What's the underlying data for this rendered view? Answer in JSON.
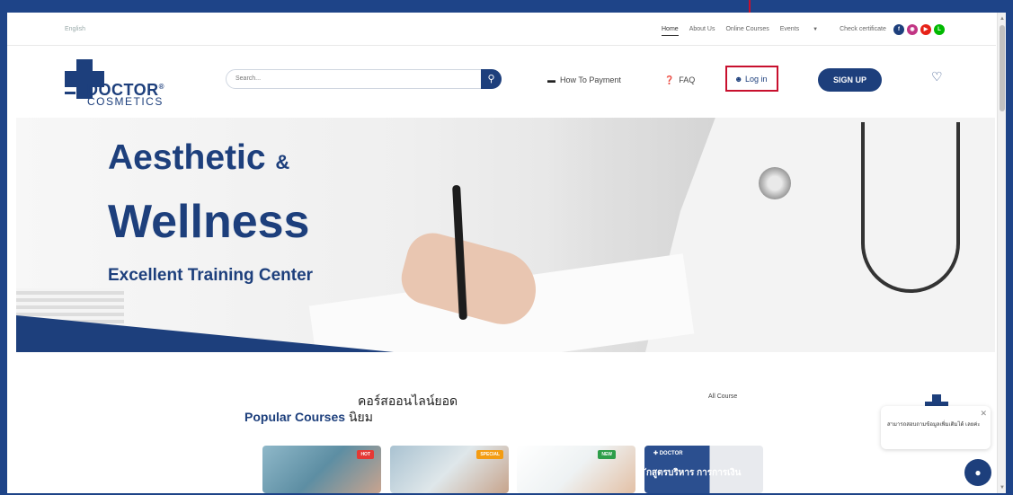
{
  "topbar": {
    "language": "English",
    "nav": [
      "Home",
      "About Us",
      "Online Courses",
      "Events",
      "Check certificate"
    ],
    "social": [
      {
        "icon": "facebook-icon",
        "color": "#1d3f7c"
      },
      {
        "icon": "instagram-icon",
        "color": "#c13584"
      },
      {
        "icon": "youtube-icon",
        "color": "#e62117"
      },
      {
        "icon": "line-icon",
        "color": "#00b900"
      }
    ]
  },
  "header": {
    "logo_main": "DOCTOR",
    "logo_sub": "COSMETICS",
    "search_placeholder": "Search...",
    "how_to_payment": "How To Payment",
    "faq": "FAQ",
    "login": "Log in",
    "signup": "SIGN UP"
  },
  "hero": {
    "title_line1": "Aesthetic",
    "title_amp": "&",
    "title_line2": "Wellness",
    "subtitle": "Excellent Training Center"
  },
  "courses": {
    "thai_line1": "คอร์สออนไลน์ยอด",
    "title": "Popular Courses",
    "thai_line2": "นิยม",
    "all_course": "All Course",
    "cards": [
      {
        "badge": "HOT",
        "badge_color": "#e53935"
      },
      {
        "badge": "SPECIAL",
        "badge_color": "#f39c12"
      },
      {
        "badge": "NEW",
        "badge_color": "#2e9e4a"
      },
      {
        "badge": "",
        "text": "ักสูตรบริหาร การการเงิน"
      }
    ]
  },
  "chat": {
    "message": "สามารถสอบถามข้อมูลเพิ่มเติมได้ เลยค่ะ"
  },
  "colors": {
    "brand": "#1d3f7c",
    "frame": "#1e4488",
    "highlight": "#c8102e"
  }
}
